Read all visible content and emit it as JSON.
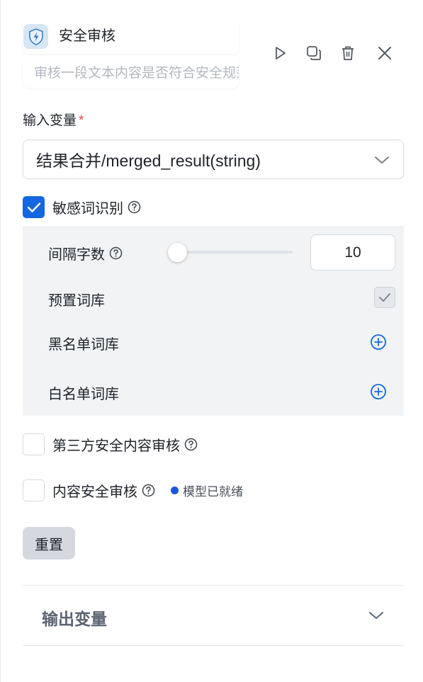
{
  "node": {
    "title": "安全审核",
    "description": "审核一段文本内容是否符合安全规范"
  },
  "toolbar": {
    "run": "play-icon",
    "copy": "copy-icon",
    "delete": "trash-icon",
    "close": "close-icon"
  },
  "input": {
    "label": "输入变量",
    "required_mark": "*",
    "selected_value": "结果合并/merged_result(string)"
  },
  "sensitive": {
    "label": "敏感词识别",
    "checked": true,
    "interval_label": "间隔字数",
    "interval_value": "10",
    "interval_fraction": 0.0,
    "preset_label": "预置词库",
    "preset_checked": true,
    "blacklist_label": "黑名单词库",
    "whitelist_label": "白名单词库"
  },
  "third_party": {
    "label": "第三方安全内容审核",
    "checked": false
  },
  "content_audit": {
    "label": "内容安全审核",
    "checked": false,
    "status_text": "模型已就绪"
  },
  "reset_label": "重置",
  "output": {
    "title": "输出变量"
  },
  "colors": {
    "accent": "#1467e0",
    "status_dot": "#1a56db",
    "required": "#e5484d"
  }
}
